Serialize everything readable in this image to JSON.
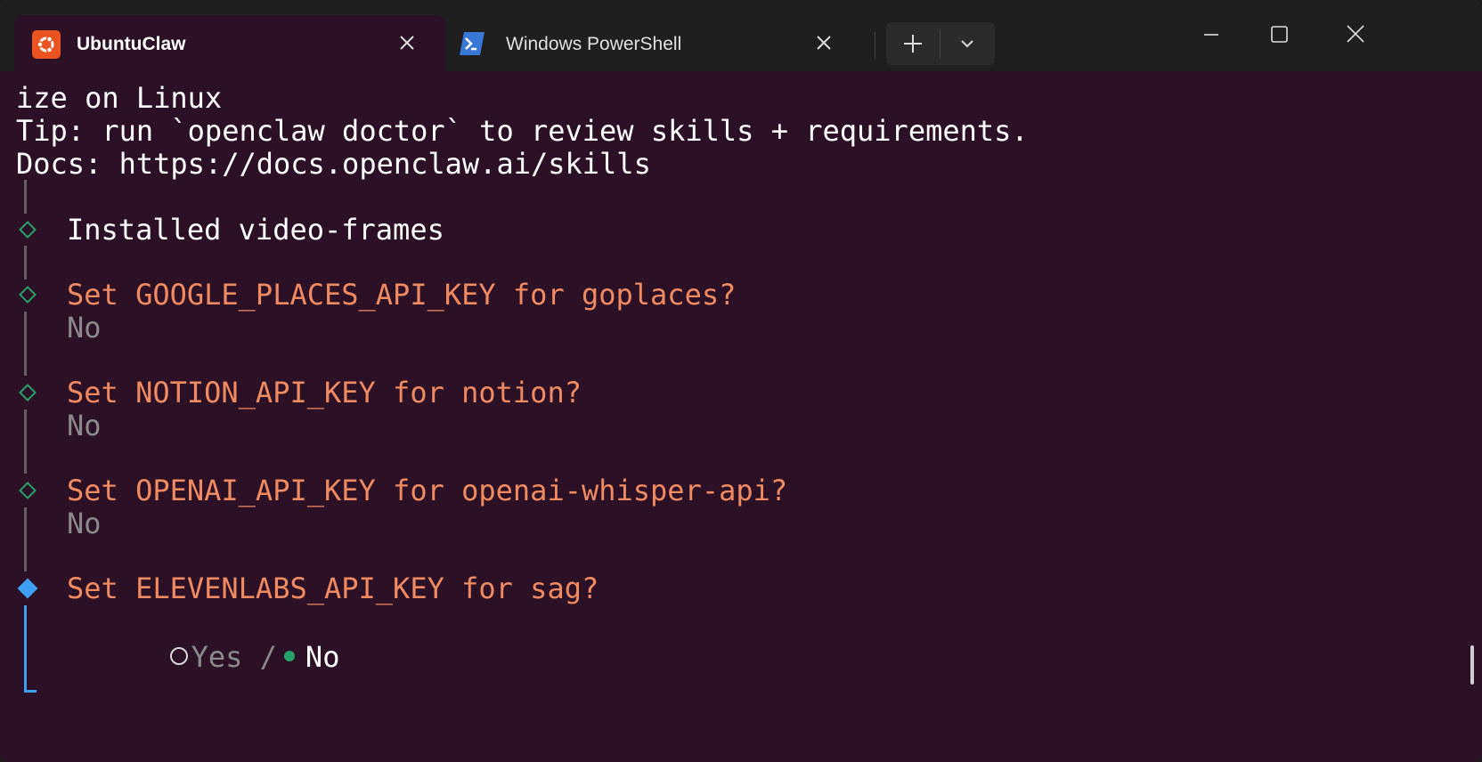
{
  "tabs": [
    {
      "title": "UbuntuClaw",
      "icon": "ubuntu-icon",
      "active": true
    },
    {
      "title": "Windows PowerShell",
      "icon": "powershell-icon",
      "active": false
    }
  ],
  "controls": {
    "new_tab_icon": "plus-icon",
    "dropdown_icon": "chevron-down-icon",
    "minimize_icon": "minimize-icon",
    "maximize_icon": "maximize-icon",
    "close_icon": "close-icon"
  },
  "terminal": {
    "lines": [
      "ize on Linux",
      "Tip: run `openclaw doctor` to review skills + requirements.",
      "Docs: https://docs.openclaw.ai/skills"
    ],
    "installed": "Installed video-frames",
    "prompts": [
      {
        "question": "Set GOOGLE_PLACES_API_KEY for goplaces?",
        "answer": "No"
      },
      {
        "question": "Set NOTION_API_KEY for notion?",
        "answer": "No"
      },
      {
        "question": "Set OPENAI_API_KEY for openai-whisper-api?",
        "answer": "No"
      }
    ],
    "active_prompt": {
      "question": "Set ELEVENLABS_API_KEY for sag?",
      "option_yes": "Yes",
      "separator": "/",
      "option_no": "No",
      "selected": "No"
    }
  },
  "colors": {
    "background": "#2c1126",
    "prompt": "#f08a61",
    "done_marker": "#26a269",
    "active_marker": "#3ea0f2",
    "ubuntu": "#e95420"
  }
}
